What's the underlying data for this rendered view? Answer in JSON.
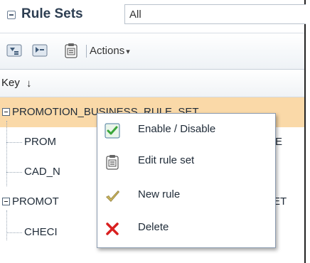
{
  "panel": {
    "title": "Rule Sets",
    "filter_value": "All"
  },
  "toolbar": {
    "actions_label": "Actions"
  },
  "column": {
    "key_label": "Key",
    "sort_glyph": "↓"
  },
  "tree": {
    "rows": [
      {
        "label": "PROMOTION_BUSINESS_RULE_SET",
        "level": 0,
        "selected": true
      },
      {
        "label": "PROM",
        "trailing": "E",
        "level": 1
      },
      {
        "label": "CAD_N",
        "level": 1
      },
      {
        "label": "PROMOT",
        "trailing": "ET",
        "level": 0
      },
      {
        "label": "CHECI",
        "level": 1
      }
    ]
  },
  "context_menu": {
    "items": [
      {
        "label": "Enable / Disable",
        "icon": "checkbox-check-icon"
      },
      {
        "label": "Edit rule set",
        "icon": "clipboard-icon"
      },
      {
        "label": "New rule",
        "icon": "checkmark-icon"
      },
      {
        "label": "Delete",
        "icon": "red-x-icon"
      }
    ]
  },
  "colors": {
    "selected_row": "#fad9a8",
    "title_text": "#2d3e52",
    "delete_red": "#d92020",
    "check_green": "#3aa63a"
  }
}
